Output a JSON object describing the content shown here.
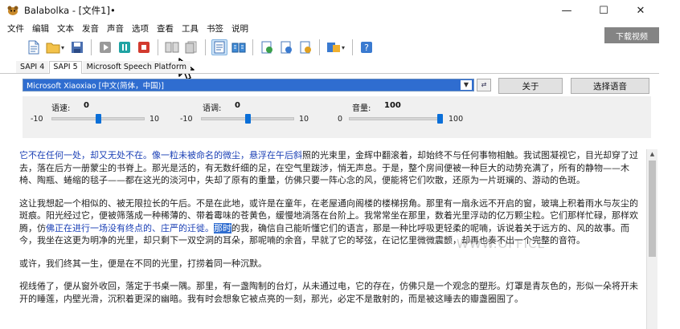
{
  "window": {
    "title": "Balabolka - [文件1]•",
    "controls": [
      "—",
      "☐",
      "✕"
    ]
  },
  "menu": [
    "文件",
    "编辑",
    "文本",
    "发音",
    "声音",
    "选项",
    "查看",
    "工具",
    "书签",
    "说明"
  ],
  "overlay_button": "下载视频",
  "tabs": [
    "SAPI 4",
    "SAPI 5",
    "Microsoft Speech Platform"
  ],
  "active_tab": "SAPI 5",
  "voice": {
    "selected": "Microsoft Xiaoxiao [中文(简体，中国)]",
    "about_button": "关于",
    "select_button": "选择语音"
  },
  "sliders": {
    "speed": {
      "label": "语速:",
      "value": "0",
      "min": "-10",
      "max": "10",
      "level": 0.5
    },
    "pitch": {
      "label": "语调:",
      "value": "0",
      "min": "-10",
      "max": "10",
      "level": 0.5
    },
    "volume": {
      "label": "音量:",
      "value": "100",
      "min": "0",
      "max": "100",
      "level": 1.0
    }
  },
  "text": {
    "p1_blue": "它不在任何一处，却又无处不在。像一粒未被命名的微尘，悬浮在午后斜",
    "p1_rest": "照的光束里，金辉中翻滚着，却始终不与任何事物相触。我试图凝视它，目光却穿了过去，落在后方一册蒙尘的书脊上。那光是活的，有无数纤细的足，在空气里跋涉，悄无声息。于是，整个房间便被一种巨大的动势充满了，所有的静物——木椅、陶瓶、蜷缩的毯子——都在这光的淡河中，失却了原有的重量，仿佛只要一阵心念的风，便能将它们吹散，还原为一片斑斓的、游动的色斑。",
    "p2_a": "这让我想起一个相似的、被无限拉长的午后。不是在此地，或许是在童年，在老屋通向阁楼的楼梯拐角。那里有一扇永远不开启的窗，玻璃上积着雨水与灰尘的斑痕。阳光经过它，便被筛落成一种稀薄的、带着霉味的苍黄色，缓慢地淌落在台阶上。我常常坐在那里，数着光里浮动的亿万颗尘粒。它们那样忙碌，那样欢腾，仿",
    "p2_blue": "佛正在进行一场没有终点的、庄严的迁徙。",
    "p2_hl": "那时",
    "p2_rest": "的我，确信自己能听懂它们的语言，那是一种比呼吸更轻柔的呢喃，诉说着关于远方的、风的故事。而今，我坐在这更为明净的光里，却只剩下一双空洞的耳朵，那呢喃的余音，早就了它的琴弦，在记忆里微微震颤，却再也奏不出一个完整的音符。",
    "p3": "或许，我们终其一生，便是在不同的光里，打捞着同一种沉默。",
    "p4": "视线倦了，便从窗外收回，落定于书桌一隅。那里，有一盏陶制的台灯，从未通过电，它的存在，仿佛只是一个观念的塑形。灯罩是青灰色的，形似一朵将开未开的睡莲，内壁光滑，沉积着更深的幽暗。我有时会想象它被点亮的一刻，那光，必定不是散射的，而是被这睡去的瓣盏圈囿了。"
  },
  "watermark": "WWW.OFFICE"
}
